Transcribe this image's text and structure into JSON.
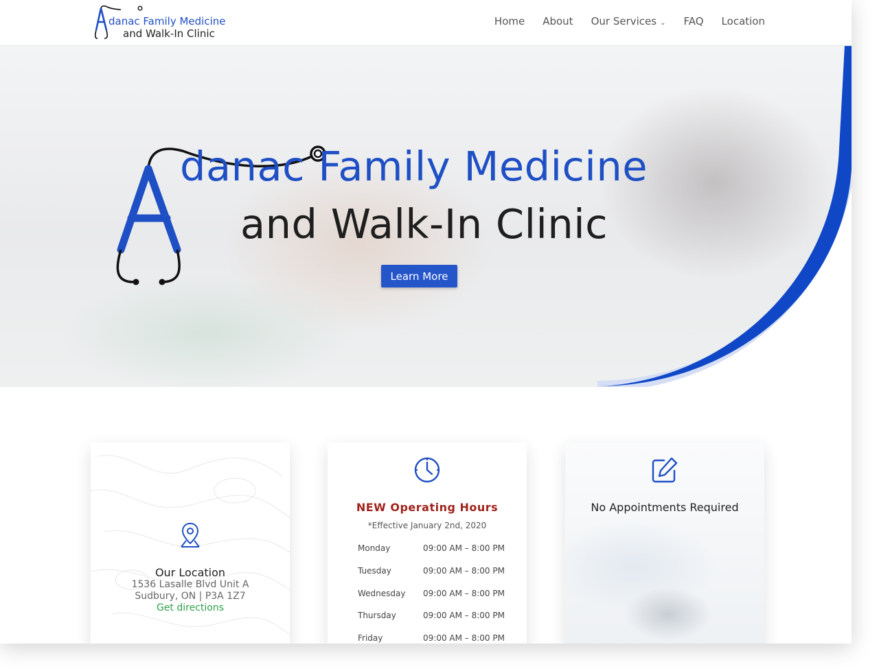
{
  "header": {
    "logo_line1": "danac Family Medicine",
    "logo_line2": "and Walk-In Clinic",
    "nav": [
      {
        "label": "Home"
      },
      {
        "label": "About"
      },
      {
        "label": "Our Services"
      },
      {
        "label": "FAQ"
      },
      {
        "label": "Location"
      }
    ]
  },
  "hero": {
    "line1": "danac Family Medicine",
    "line2": "and Walk-In Clinic",
    "button": "Learn More"
  },
  "cards": {
    "location": {
      "icon": "map-pin-icon",
      "title": "Our Location",
      "address1": "1536 Lasalle Blvd Unit A",
      "address2": "Sudbury, ON | P3A 1Z7",
      "link": "Get directions"
    },
    "hours": {
      "icon": "clock-icon",
      "title": "NEW Operating Hours",
      "subtitle": "*Effective January 2nd, 2020",
      "rows": [
        {
          "day": "Monday",
          "time": "09:00 AM – 8:00 PM"
        },
        {
          "day": "Tuesday",
          "time": "09:00 AM – 8:00 PM"
        },
        {
          "day": "Wednesday",
          "time": "09:00 AM – 8:00 PM"
        },
        {
          "day": "Thursday",
          "time": "09:00 AM – 8:00 PM"
        },
        {
          "day": "Friday",
          "time": "09:00 AM – 8:00 PM"
        }
      ]
    },
    "appointments": {
      "icon": "edit-icon",
      "title": "No Appointments Required"
    }
  },
  "colors": {
    "brand_blue": "#1f4fc4",
    "hours_red": "#a0231c",
    "link_green": "#2ea14b"
  }
}
